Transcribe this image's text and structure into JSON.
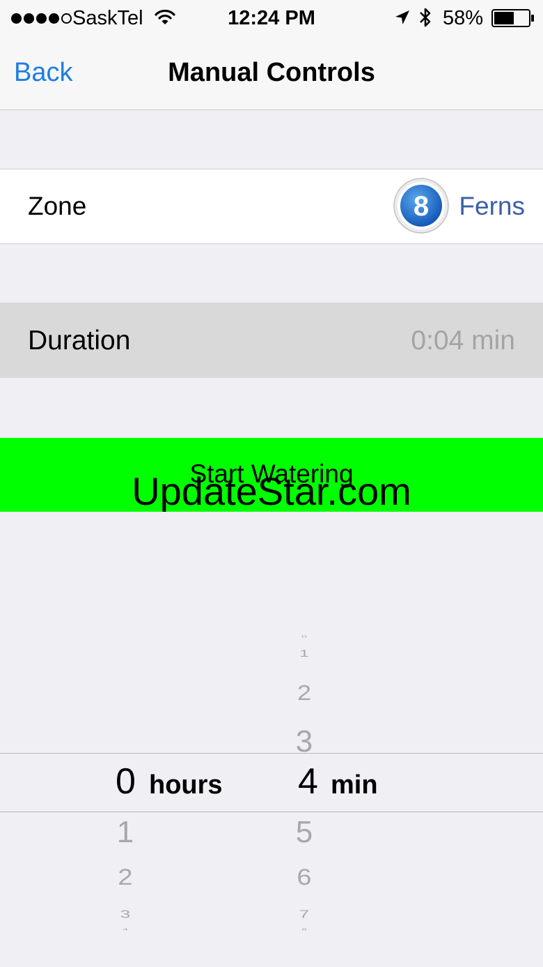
{
  "status_bar": {
    "carrier": "SaskTel",
    "time": "12:24 PM",
    "battery": "58%",
    "battery_level": 0.58,
    "signal_bars_filled": 4,
    "signal_bars_total": 5
  },
  "nav": {
    "back_label": "Back",
    "title": "Manual Controls"
  },
  "zone": {
    "label": "Zone",
    "number": "8",
    "name": "Ferns"
  },
  "duration": {
    "label": "Duration",
    "value": "0:04 min"
  },
  "actions": {
    "start_label": "Start Watering"
  },
  "watermark": "UpdateStar.com",
  "picker": {
    "hours": {
      "above": [],
      "selected": "0",
      "unit": "hours",
      "below": [
        "1",
        "2",
        "3",
        "4"
      ]
    },
    "minutes": {
      "above": [
        "0",
        "1",
        "2",
        "3"
      ],
      "selected": "4",
      "unit": "min",
      "below": [
        "5",
        "6",
        "7",
        "8"
      ]
    }
  },
  "colors": {
    "accent": "#1b7fe0",
    "start_button": "#00ff00",
    "zone_name": "#3b5ea8"
  }
}
